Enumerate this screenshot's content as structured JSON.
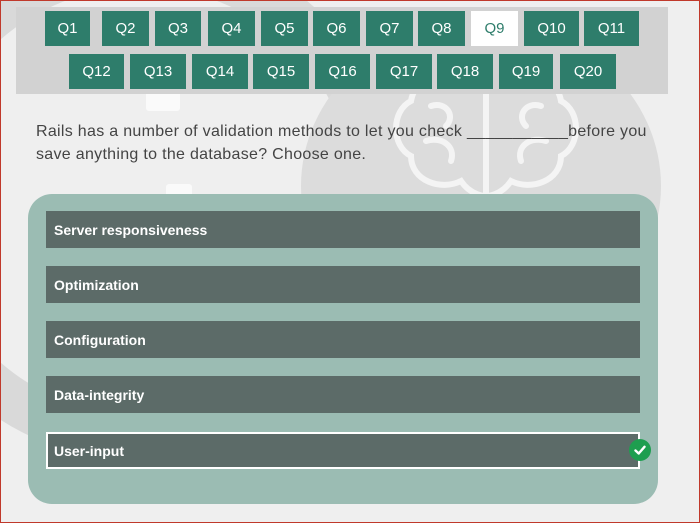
{
  "nav": {
    "row1": [
      "Q1",
      "Q2",
      "Q3",
      "Q4",
      "Q5",
      "Q6",
      "Q7",
      "Q8",
      "Q9",
      "Q10",
      "Q11"
    ],
    "row2": [
      "Q12",
      "Q13",
      "Q14",
      "Q15",
      "Q16",
      "Q17",
      "Q18",
      "Q19",
      "Q20"
    ],
    "current": "Q9"
  },
  "question": {
    "text": "Rails has a number of validation methods to let you check ___________before you save anything to the database? Choose one."
  },
  "options": [
    {
      "label": "Server responsiveness",
      "selected": false
    },
    {
      "label": "Optimization",
      "selected": false
    },
    {
      "label": "Configuration",
      "selected": false
    },
    {
      "label": "Data-integrity",
      "selected": false
    },
    {
      "label": "User-input",
      "selected": true
    }
  ],
  "colors": {
    "accent": "#2e7d6b",
    "panel": "#9bbcb3",
    "option": "#5c6b68",
    "check": "#1e9e4f"
  },
  "icons": {
    "selected_marker": "check-circle-icon",
    "background": "brain-icon"
  }
}
